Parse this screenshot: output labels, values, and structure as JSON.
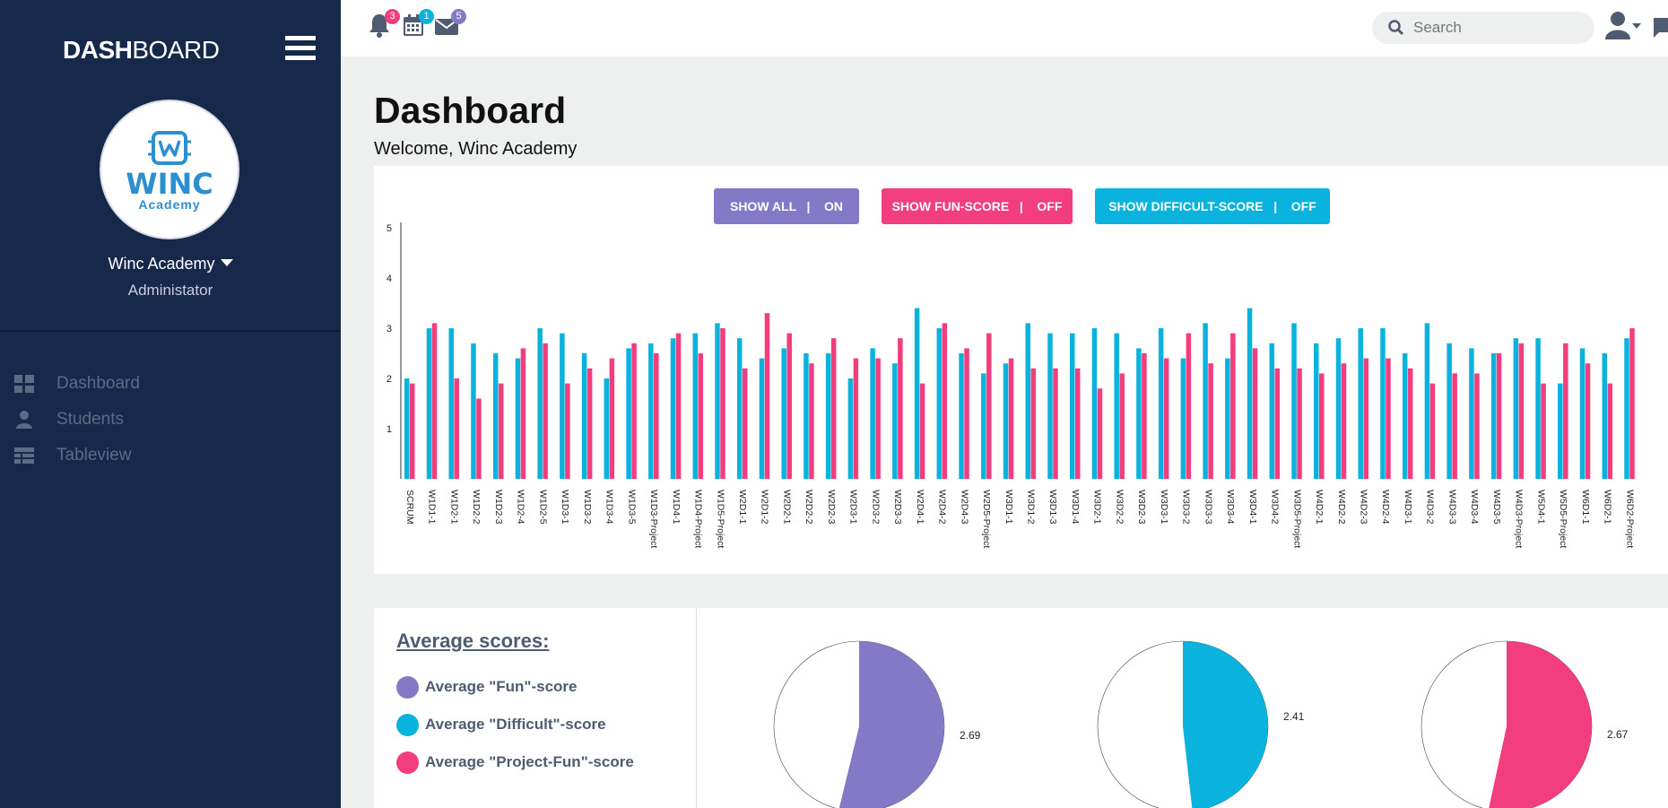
{
  "brand": {
    "part1": "DASH",
    "part2": "BOARD"
  },
  "profile": {
    "logo_name": "WINC",
    "logo_sub": "Academy",
    "name": "Winc Academy",
    "role": "Administator"
  },
  "nav": [
    {
      "label": "Dashboard",
      "icon": "dashboard-icon"
    },
    {
      "label": "Students",
      "icon": "user-icon"
    },
    {
      "label": "Tableview",
      "icon": "table-icon"
    }
  ],
  "topbar": {
    "notifications_count": "3",
    "calendar_count": "1",
    "messages_count": "5",
    "search_placeholder": "Search"
  },
  "page": {
    "title": "Dashboard",
    "welcome": "Welcome, Winc Academy"
  },
  "toggles": {
    "show_all": "SHOW ALL   |    ON",
    "show_fun": "SHOW FUN-SCORE   |    OFF",
    "show_difficult": "SHOW DIFFICULT-SCORE   |    OFF"
  },
  "colors": {
    "sidebar": "#17294a",
    "purple": "#8479c7",
    "pink": "#f23d7e",
    "cyan": "#09b3dd",
    "red_badge": "#f23d7e",
    "cyan_badge": "#09b3dd",
    "purple_badge": "#8479c7"
  },
  "chart_data": {
    "type": "bar",
    "ylim": [
      0,
      5
    ],
    "yticks": [
      1,
      2,
      3,
      4,
      5
    ],
    "categories": [
      "SCRUM",
      "W1D1-1",
      "W1D2-1",
      "W1D2-2",
      "W1D2-3",
      "W1D2-4",
      "W1D2-5",
      "W1D3-1",
      "W1D3-2",
      "W1D3-4",
      "W1D3-5",
      "W1D3-Project",
      "W1D4-1",
      "W1D4-Project",
      "W1D5-Project",
      "W2D1-1",
      "W2D1-2",
      "W2D2-1",
      "W2D2-2",
      "W2D2-3",
      "W2D3-1",
      "W2D3-2",
      "W2D3-3",
      "W2D4-1",
      "W2D4-2",
      "W2D4-3",
      "W2D5-Project",
      "W3D1-1",
      "W3D1-2",
      "W3D1-3",
      "W3D1-4",
      "W3D2-1",
      "W3D2-2",
      "W3D2-3",
      "W3D3-1",
      "W3D3-2",
      "W3D3-3",
      "W3D3-4",
      "W3D4-1",
      "W3D4-2",
      "W3D5-Project",
      "W4D2-1",
      "W4D2-2",
      "W4D2-3",
      "W4D2-4",
      "W4D3-1",
      "W4D3-2",
      "W4D3-3",
      "W4D3-4",
      "W4D3-5",
      "W4D3-Project",
      "W5D4-1",
      "W5D5-Project",
      "W6D1-1",
      "W6D2-1",
      "W6D2-Project"
    ],
    "series": [
      {
        "color": "#09b3dd",
        "values": [
          2.0,
          3.0,
          3.0,
          2.7,
          2.5,
          2.4,
          3.0,
          2.9,
          2.5,
          2.0,
          2.6,
          2.7,
          2.8,
          2.9,
          3.1,
          2.8,
          2.4,
          2.6,
          2.5,
          2.5,
          2.0,
          2.6,
          2.3,
          3.4,
          3.0,
          2.5,
          2.1,
          2.3,
          3.1,
          2.9,
          2.9,
          3.0,
          2.9,
          2.6,
          3.0,
          2.4,
          3.1,
          2.4,
          3.4,
          2.7,
          3.1,
          2.7,
          2.8,
          3.0,
          3.0,
          2.5,
          3.1,
          2.7,
          2.6,
          2.5,
          2.8,
          2.8,
          1.9,
          2.6,
          2.5,
          2.8
        ]
      },
      {
        "color": "#f23d7e",
        "values": [
          1.9,
          3.1,
          2.0,
          1.6,
          1.9,
          2.6,
          2.7,
          1.9,
          2.2,
          2.4,
          2.7,
          2.5,
          2.9,
          2.5,
          3.0,
          2.2,
          3.3,
          2.9,
          2.3,
          2.8,
          2.4,
          2.4,
          2.8,
          1.9,
          3.1,
          2.6,
          2.9,
          2.4,
          2.2,
          2.2,
          2.2,
          1.8,
          2.1,
          2.5,
          2.4,
          2.9,
          2.3,
          2.9,
          2.6,
          2.2,
          2.2,
          2.1,
          2.3,
          2.4,
          2.4,
          2.2,
          1.9,
          2.1,
          2.1,
          2.5,
          2.7,
          1.9,
          2.7,
          2.3,
          1.9,
          3.0
        ]
      }
    ]
  },
  "averages": {
    "title": "Average scores:",
    "items": [
      {
        "label": "Average \"Fun\"-score",
        "color": "#8479c7",
        "value": 2.69,
        "value_label": "2.69"
      },
      {
        "label": "Average \"Difficult\"-score",
        "color": "#09b3dd",
        "value": 2.41,
        "value_label": "2.41"
      },
      {
        "label": "Average \"Project-Fun\"-score",
        "color": "#f23d7e",
        "value": 2.67,
        "value_label": "2.67"
      }
    ],
    "max": 5
  }
}
